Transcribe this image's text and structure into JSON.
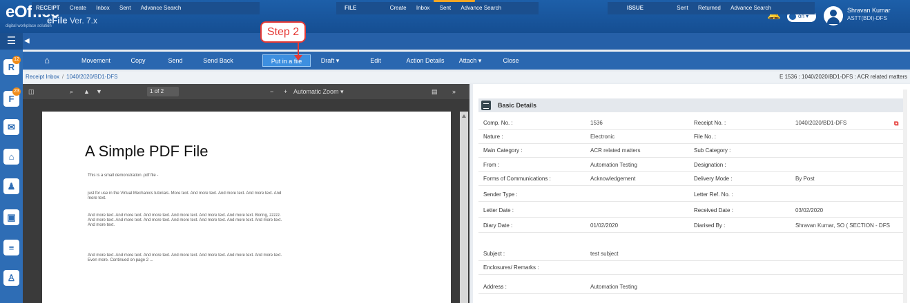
{
  "header": {
    "logo_text": "eOffice",
    "logo_tagline": "digital workplace solution",
    "module": "eFile",
    "version": "Ver. 7.x",
    "notification_count": "12",
    "toggle_label": "on",
    "user_name": "Shravan Kumar",
    "user_role": "ASTT(BDI)-DFS"
  },
  "sidebar": {
    "badges": [
      "12",
      "23"
    ],
    "icons": [
      "receipt-icon",
      "file-icon",
      "mail-icon",
      "inbox-icon",
      "user-file-icon",
      "folder-icon",
      "list-icon",
      "person-icon"
    ]
  },
  "menu": {
    "receipt": {
      "head": "RECEIPT",
      "items": [
        "Create",
        "Inbox",
        "Sent",
        "Advance Search"
      ]
    },
    "file": {
      "head": "FILE",
      "items": [
        "Create",
        "Inbox",
        "Sent",
        "Advance Search"
      ]
    },
    "issue": {
      "head": "ISSUE",
      "items": [
        "Sent",
        "Returned",
        "Advance Search"
      ]
    }
  },
  "callout": {
    "text": "Step 2"
  },
  "toolbar": {
    "home": "⌂",
    "movement": "Movement",
    "copy": "Copy",
    "send": "Send",
    "send_back": "Send Back",
    "put_in_file": "Put in a file",
    "draft": "Draft ▾",
    "edit": "Edit",
    "action_details": "Action Details",
    "attach": "Attach ▾",
    "close": "Close"
  },
  "breadcrumb": {
    "items": [
      "Receipt Inbox",
      "1040/2020/BD1-DFS"
    ],
    "file_ref": "E 1536 : 1040/2020/BD1-DFS : ACR related matters"
  },
  "pdf_viewer": {
    "page": "1",
    "of_pages": "of 2",
    "zoom": "Automatic Zoom",
    "doc_title": "A Simple PDF File",
    "paragraphs": [
      "This is a small demonstration .pdf file -",
      "just for use in the Virtual Mechanics tutorials. More text. And more text. And more text. And more text. And more text.",
      "And more text. And more text. And more text. And more text. And more text. And more text. Boring, zzzzz. And more text. And more text. And more text. And more text. And more text. And more text. And more text. And more text.",
      "And more text. And more text. And more text. And more text. And more text. And more text. And more text. Even more. Continued on page 2 ..."
    ]
  },
  "details": {
    "title": "Basic Details",
    "rows": [
      {
        "l1": "Comp. No. :",
        "v1": "1536",
        "l2": "Receipt No. :",
        "v2": "1040/2020/BD1-DFS"
      },
      {
        "l1": "Nature :",
        "v1": "Electronic",
        "l2": "File No. :",
        "v2": ""
      },
      {
        "l1": "Main Category :",
        "v1": "ACR related matters",
        "l2": "Sub Category :",
        "v2": ""
      },
      {
        "l1": "From :",
        "v1": "Automation Testing",
        "l2": "Designation :",
        "v2": ""
      },
      {
        "l1": "Forms of Communications :",
        "v1": "Acknowledgement",
        "l2": "Delivery Mode :",
        "v2": "By Post"
      },
      {
        "l1": "Sender Type :",
        "v1": "",
        "l2": "Letter Ref. No. :",
        "v2": ""
      },
      {
        "l1": "Letter Date :",
        "v1": "",
        "l2": "Received Date :",
        "v2": "03/02/2020"
      },
      {
        "l1": "Diary Date :",
        "v1": "01/02/2020",
        "l2": "Diarised By :",
        "v2": "Shravan Kumar, SO ( SECTION - DFS"
      },
      {
        "l1": "Subject :",
        "v1": "test subject",
        "l2": "",
        "v2": ""
      },
      {
        "l1": "Enclosures/ Remarks :",
        "v1": "",
        "l2": "",
        "v2": ""
      },
      {
        "l1": "Address :",
        "v1": "Automation Testing",
        "l2": "",
        "v2": ""
      }
    ]
  }
}
